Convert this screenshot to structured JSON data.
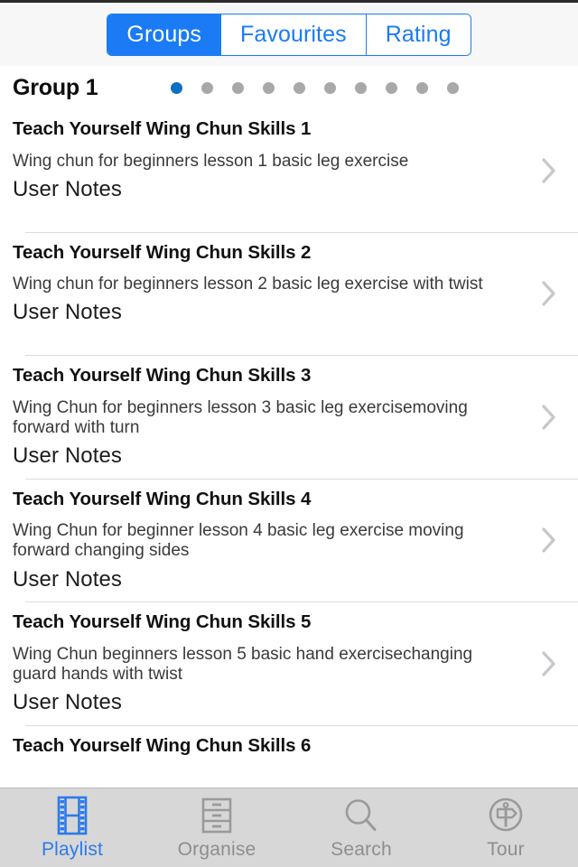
{
  "colors": {
    "accent": "#1a7bf5",
    "tab_active": "#2b7bea",
    "tab_inactive": "#8e8e8e",
    "dot_active": "#0b6fc4",
    "dot_inactive": "#a8a8a8",
    "tabbar_bg": "#d7d7d7",
    "header_bg": "#f7f7f7"
  },
  "header": {
    "segments": [
      {
        "label": "Groups",
        "active": true
      },
      {
        "label": "Favourites",
        "active": false
      },
      {
        "label": "Rating",
        "active": false
      }
    ]
  },
  "group": {
    "title": "Group 1",
    "pager": {
      "total": 10,
      "current": 1
    }
  },
  "list": {
    "notes_label": "User Notes",
    "items": [
      {
        "title": "Teach Yourself Wing Chun Skills 1",
        "description": "Wing chun for beginners lesson 1  basic leg exercise",
        "notes": "User Notes"
      },
      {
        "title": "Teach Yourself Wing Chun Skills 2",
        "description": "Wing chun for beginners lesson 2 basic leg exercise with twist",
        "notes": "User Notes"
      },
      {
        "title": "Teach Yourself Wing Chun Skills 3",
        "description": "Wing Chun for beginners lesson 3 basic leg exercisemoving forward with turn",
        "notes": "User Notes"
      },
      {
        "title": "Teach Yourself Wing Chun Skills 4",
        "description": "Wing Chun for beginner lesson 4 basic leg exercise moving forward changing sides",
        "notes": "User Notes"
      },
      {
        "title": "Teach Yourself Wing Chun Skills 5",
        "description": "Wing Chun beginners lesson 5 basic hand exercisechanging guard hands with twist",
        "notes": "User Notes"
      },
      {
        "title": "Teach Yourself Wing Chun Skills 6",
        "description": "",
        "notes": ""
      }
    ],
    "disclosure_icon": "chevron-right-icon"
  },
  "tabbar": {
    "tabs": [
      {
        "label": "Playlist",
        "icon": "film-strip-icon",
        "active": true
      },
      {
        "label": "Organise",
        "icon": "filing-cabinet-icon",
        "active": false
      },
      {
        "label": "Search",
        "icon": "magnifier-icon",
        "active": false
      },
      {
        "label": "Tour",
        "icon": "signpost-circle-icon",
        "active": false
      }
    ]
  }
}
